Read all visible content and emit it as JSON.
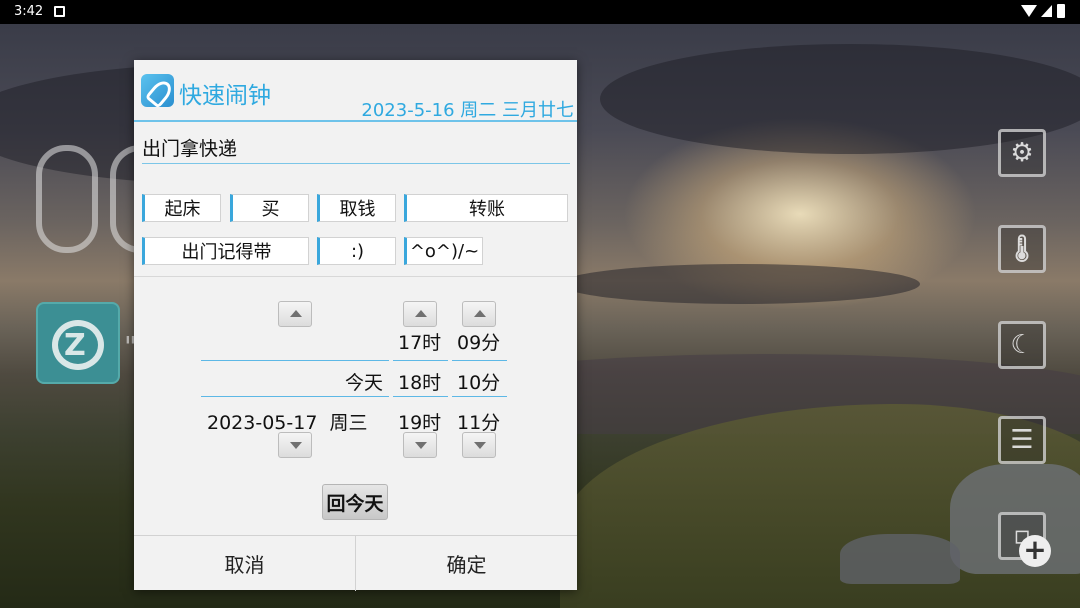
{
  "status_bar": {
    "time": "3:42"
  },
  "dialog": {
    "title": "快速闹钟",
    "date": "2023-5-16 周二 三月廿七",
    "memo_value": "出门拿快递",
    "chips_row1": [
      "起床",
      "买",
      "取钱",
      "转账"
    ],
    "chips_row2": [
      "出门记得带",
      ":)",
      "^o^)/~"
    ],
    "picker": {
      "day_prev": "",
      "day_current": "今天",
      "day_next": "2023-05-17  周三",
      "hour_prev": "17时",
      "hour_current": "18时",
      "hour_next": "19时",
      "minute_prev": "09分",
      "minute_current": "10分",
      "minute_next": "11分"
    },
    "today_button": "回今天",
    "cancel_button": "取消",
    "confirm_button": "确定"
  },
  "side_buttons": [
    "settings-icon",
    "thermometer-icon",
    "night-mode-icon",
    "list-icon",
    "add-widget-icon"
  ],
  "colors": {
    "accent": "#2fa9e0",
    "divider": "#6ec3ea",
    "dialog_bg": "#f2f2f2"
  }
}
